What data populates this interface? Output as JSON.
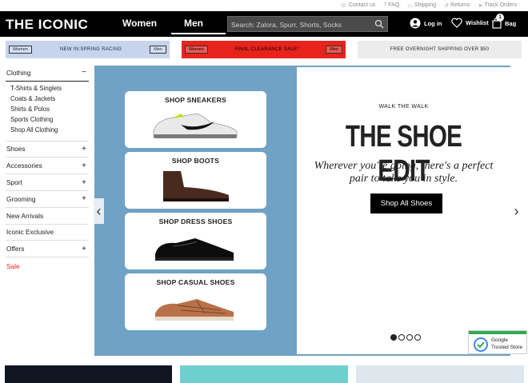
{
  "utility_links": [
    "Contact us",
    "FAQ",
    "Shipping",
    "Returns",
    "Track Orders"
  ],
  "header": {
    "logo": "THE ICONIC",
    "nav": [
      "Women",
      "Men"
    ],
    "search_placeholder": "Search: Zalora, Spurr, Shorts, Socks",
    "login": "Log in",
    "wishlist": "Wishlist",
    "bag": "Bag",
    "bag_count": "1"
  },
  "promos": [
    {
      "left": "Women",
      "text": "NEW IN:SPRING RACING",
      "right": "Men",
      "bg": "#c7d4ec"
    },
    {
      "left": "Women",
      "text": "FINAL CLEARANCE SALE*",
      "right": "Men",
      "bg": "#e8231c"
    },
    {
      "text": "FREE OVERNIGHT SHIPPING OVER $50",
      "bg": "#ececec"
    }
  ],
  "sidebar": {
    "clothing": {
      "label": "Clothing",
      "sign": "−",
      "items": [
        "T-Shirts & Singlets",
        "Coats & Jackets",
        "Shirts & Polos",
        "Sports Clothing",
        "Shop All Clothing"
      ]
    },
    "categories": [
      {
        "label": "Shoes",
        "sign": "+"
      },
      {
        "label": "Accessories",
        "sign": "+"
      },
      {
        "label": "Sport",
        "sign": "+"
      },
      {
        "label": "Grooming",
        "sign": "+"
      },
      {
        "label": "New Arrivals",
        "sign": ""
      },
      {
        "label": "Iconic Exclusive",
        "sign": ""
      },
      {
        "label": "Offers",
        "sign": "+"
      },
      {
        "label": "Sale",
        "sign": ""
      }
    ]
  },
  "hero": {
    "tiles": [
      "SHOP SNEAKERS",
      "SHOP BOOTS",
      "SHOP DRESS SHOES",
      "SHOP CASUAL SHOES"
    ],
    "kicker": "WALK THE WALK",
    "title": "THE SHOE EDIT",
    "subtitle_line1": "Wherever you're going, there's a perfect",
    "subtitle_line2": "pair to take you in style.",
    "cta": "Shop All Shoes",
    "dots": 4,
    "active_dot": 0
  },
  "badge": {
    "line1": "Google",
    "line2": "Trusted Store"
  },
  "colors": {
    "header": "#000000",
    "hero_bg": "#6fa2c4",
    "sale_red": "#e8231c"
  }
}
